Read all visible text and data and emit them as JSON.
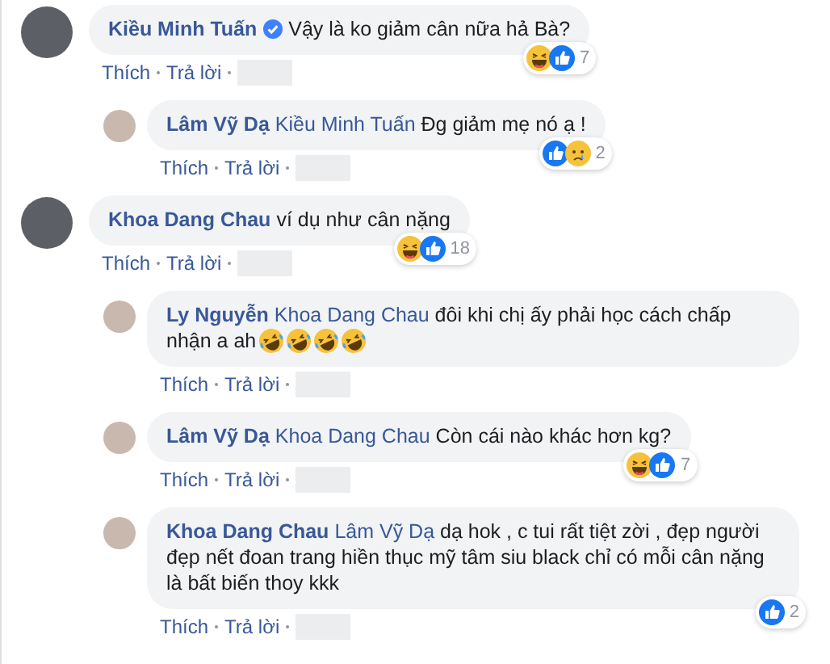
{
  "comments": [
    {
      "author": "Kiều Minh Tuấn",
      "verified": true,
      "text": "Vậy là ko giảm cân nữa hả Bà?",
      "reactions": {
        "icons": [
          {
            "kind": "haha"
          },
          {
            "kind": "like"
          }
        ],
        "count": "7"
      },
      "actions": [
        "Thích",
        "Trả lời"
      ],
      "replies": [
        {
          "author": "Lâm Vỹ Dạ",
          "mention": "Kiều Minh Tuấn",
          "text": "Đg giảm mẹ nó ạ !",
          "reactions": {
            "icons": [
              {
                "kind": "like"
              },
              {
                "kind": "sad"
              }
            ],
            "count": "2"
          },
          "actions": [
            "Thích",
            "Trả lời"
          ]
        }
      ]
    },
    {
      "author": "Khoa Dang Chau",
      "verified": false,
      "text": "ví dụ như cân nặng",
      "reactions": {
        "icons": [
          {
            "kind": "haha"
          },
          {
            "kind": "like"
          }
        ],
        "count": "18"
      },
      "actions": [
        "Thích",
        "Trả lời"
      ],
      "replies": [
        {
          "author": "Ly Nguyễn",
          "mention": "Khoa Dang Chau",
          "text": "đôi khi chị ấy phải học cách chấp nhận a ah",
          "emojis": [
            {
              "kind": "rofl"
            },
            {
              "kind": "rofl"
            },
            {
              "kind": "rofl"
            },
            {
              "kind": "rofl"
            }
          ],
          "actions": [
            "Thích",
            "Trả lời"
          ]
        },
        {
          "author": "Lâm Vỹ Dạ",
          "mention": "Khoa Dang Chau",
          "text": "Còn cái nào khác hơn kg?",
          "reactions": {
            "icons": [
              {
                "kind": "haha"
              },
              {
                "kind": "like"
              }
            ],
            "count": "7"
          },
          "actions": [
            "Thích",
            "Trả lời"
          ]
        },
        {
          "author": "Khoa Dang Chau",
          "mention": "Lâm Vỹ Dạ",
          "text": "dạ hok , c tui rất tiệt zời , đẹp người đẹp nết đoan trang hiền thục mỹ tâm siu black chỉ có mỗi cân nặng là bất biến thoy kkk",
          "reactions": {
            "icons": [
              {
                "kind": "like"
              }
            ],
            "count": "2"
          },
          "actions": [
            "Thích",
            "Trả lời"
          ]
        }
      ]
    }
  ]
}
